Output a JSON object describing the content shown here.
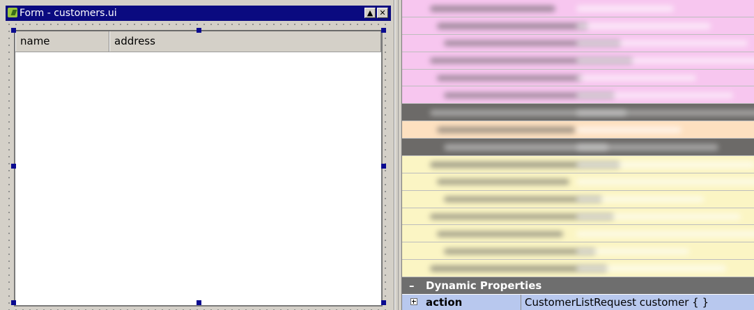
{
  "form_window": {
    "title": "Form - customers.ui",
    "minimize_label": "▲",
    "close_label": "✕",
    "table": {
      "columns": [
        "name",
        "address"
      ]
    }
  },
  "property_editor": {
    "section_title": "Dynamic Properties",
    "section_expander": "–",
    "properties": [
      {
        "name": "action",
        "value": "CustomerListRequest customer { }"
      }
    ],
    "blurred_row_colors": [
      "#f7c6ef",
      "#f7c6ef",
      "#f7c6ef",
      "#f7c6ef",
      "#f7c6ef",
      "#f7c6ef",
      "#6c6a68",
      "#fde0c0",
      "#6c6a68",
      "#fbf5c4",
      "#fbf5c4",
      "#fbf5c4",
      "#fbf5c4",
      "#fbf5c4",
      "#fbf5c4",
      "#fbf5c4"
    ]
  }
}
